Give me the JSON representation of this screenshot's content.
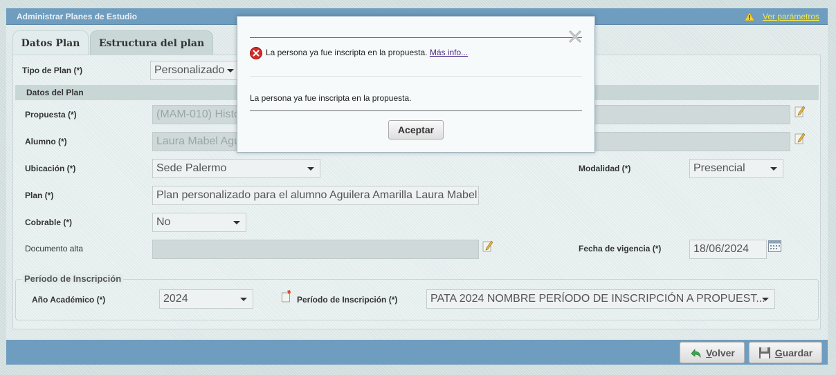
{
  "window": {
    "title": "Administrar Planes de Estudio",
    "params_link": "Ver parámetros"
  },
  "tabs": [
    {
      "label": "Datos Plan"
    },
    {
      "label": "Estructura del plan"
    }
  ],
  "form": {
    "tipo_plan": {
      "label": "Tipo de Plan (*)",
      "value": "Personalizado"
    },
    "section_title": "Datos del Plan",
    "propuesta": {
      "label": "Propuesta (*)",
      "value": "(MAM-010) Histo"
    },
    "alumno": {
      "label": "Alumno (*)",
      "value": "Laura Mabel Agu"
    },
    "ubicacion": {
      "label": "Ubicación (*)",
      "value": "Sede Palermo"
    },
    "modalidad": {
      "label": "Modalidad (*)",
      "value": "Presencial"
    },
    "plan": {
      "label": "Plan (*)",
      "value": "Plan personalizado para el alumno Aguilera Amarilla Laura Mabel"
    },
    "cobrable": {
      "label": "Cobrable (*)",
      "value": "No"
    },
    "documento_alta": {
      "label": "Documento alta",
      "value": ""
    },
    "fecha_vigencia": {
      "label": "Fecha de vigencia (*)",
      "value": "18/06/2024"
    },
    "periodo_section": "Período de Inscripción",
    "anio_academico": {
      "label": "Año Académico (*)",
      "value": "2024"
    },
    "periodo_inscripcion": {
      "label": "Período de Inscripción (*)",
      "value": "PATA 2024 NOMBRE PERÍODO DE INSCRIPCIÓN A PROPUEST..."
    }
  },
  "footer": {
    "volver": {
      "accel": "V",
      "rest": "olver"
    },
    "guardar": {
      "accel": "G",
      "rest": "uardar"
    }
  },
  "dialog": {
    "error_message": "La persona ya fue inscripta en la propuesta.",
    "more_info": "Más info...",
    "detail_message": "La persona ya fue inscripta en la propuesta.",
    "ok_label": "Aceptar"
  },
  "colors": {
    "titlebar": "#6f9dbf",
    "params_link": "#f2e84a",
    "error_icon": "#d32a2a"
  }
}
